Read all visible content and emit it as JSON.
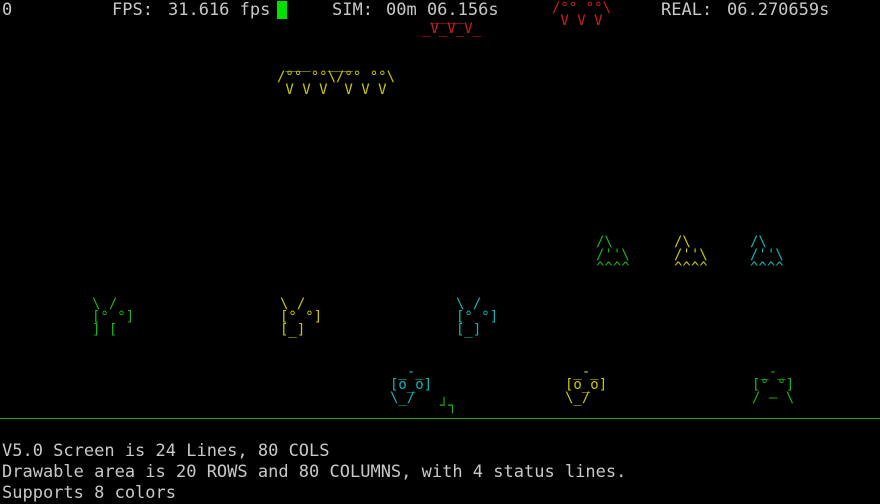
{
  "status": {
    "score": "0",
    "fps_label": "FPS:",
    "fps_value": "31.616 fps",
    "sim_label": "SIM:",
    "sim_value": "00m 06.156s",
    "real_label": "REAL:",
    "real_value": "06.270659s"
  },
  "info": {
    "line1": "V5.0 Screen is 24 Lines, 80 COLS",
    "line2": "Drawable area is 20 ROWS and 80 COLUMNS, with 4 status lines.",
    "line3": "Supports 8 colors"
  },
  "colors": {
    "red": "#d02020",
    "yellow": "#c8c800",
    "green": "#19b319",
    "cyan": "#15b3b3",
    "text": "#c8c8c8",
    "cursor": "#00e000",
    "ground": "#1ea81e"
  },
  "sprites": {
    "saucer_red_1": " ____\n_V_V_V_",
    "saucer_red_2": "/°° °°\\\n V V V",
    "saucer_yellow": " ___  ___\n/°° °°\\/°° °°\\\n V V V  V V V",
    "bug": "\\ /\n[° °]\n] [",
    "bug2": "\\ /\n[° °]\n[_]",
    "cone": "/\\\n/''\\\n^^^^",
    "robot": " _-_\n[o_o]\n\\_/",
    "robot2": " _-_\n[° °]\n/ — \\"
  }
}
